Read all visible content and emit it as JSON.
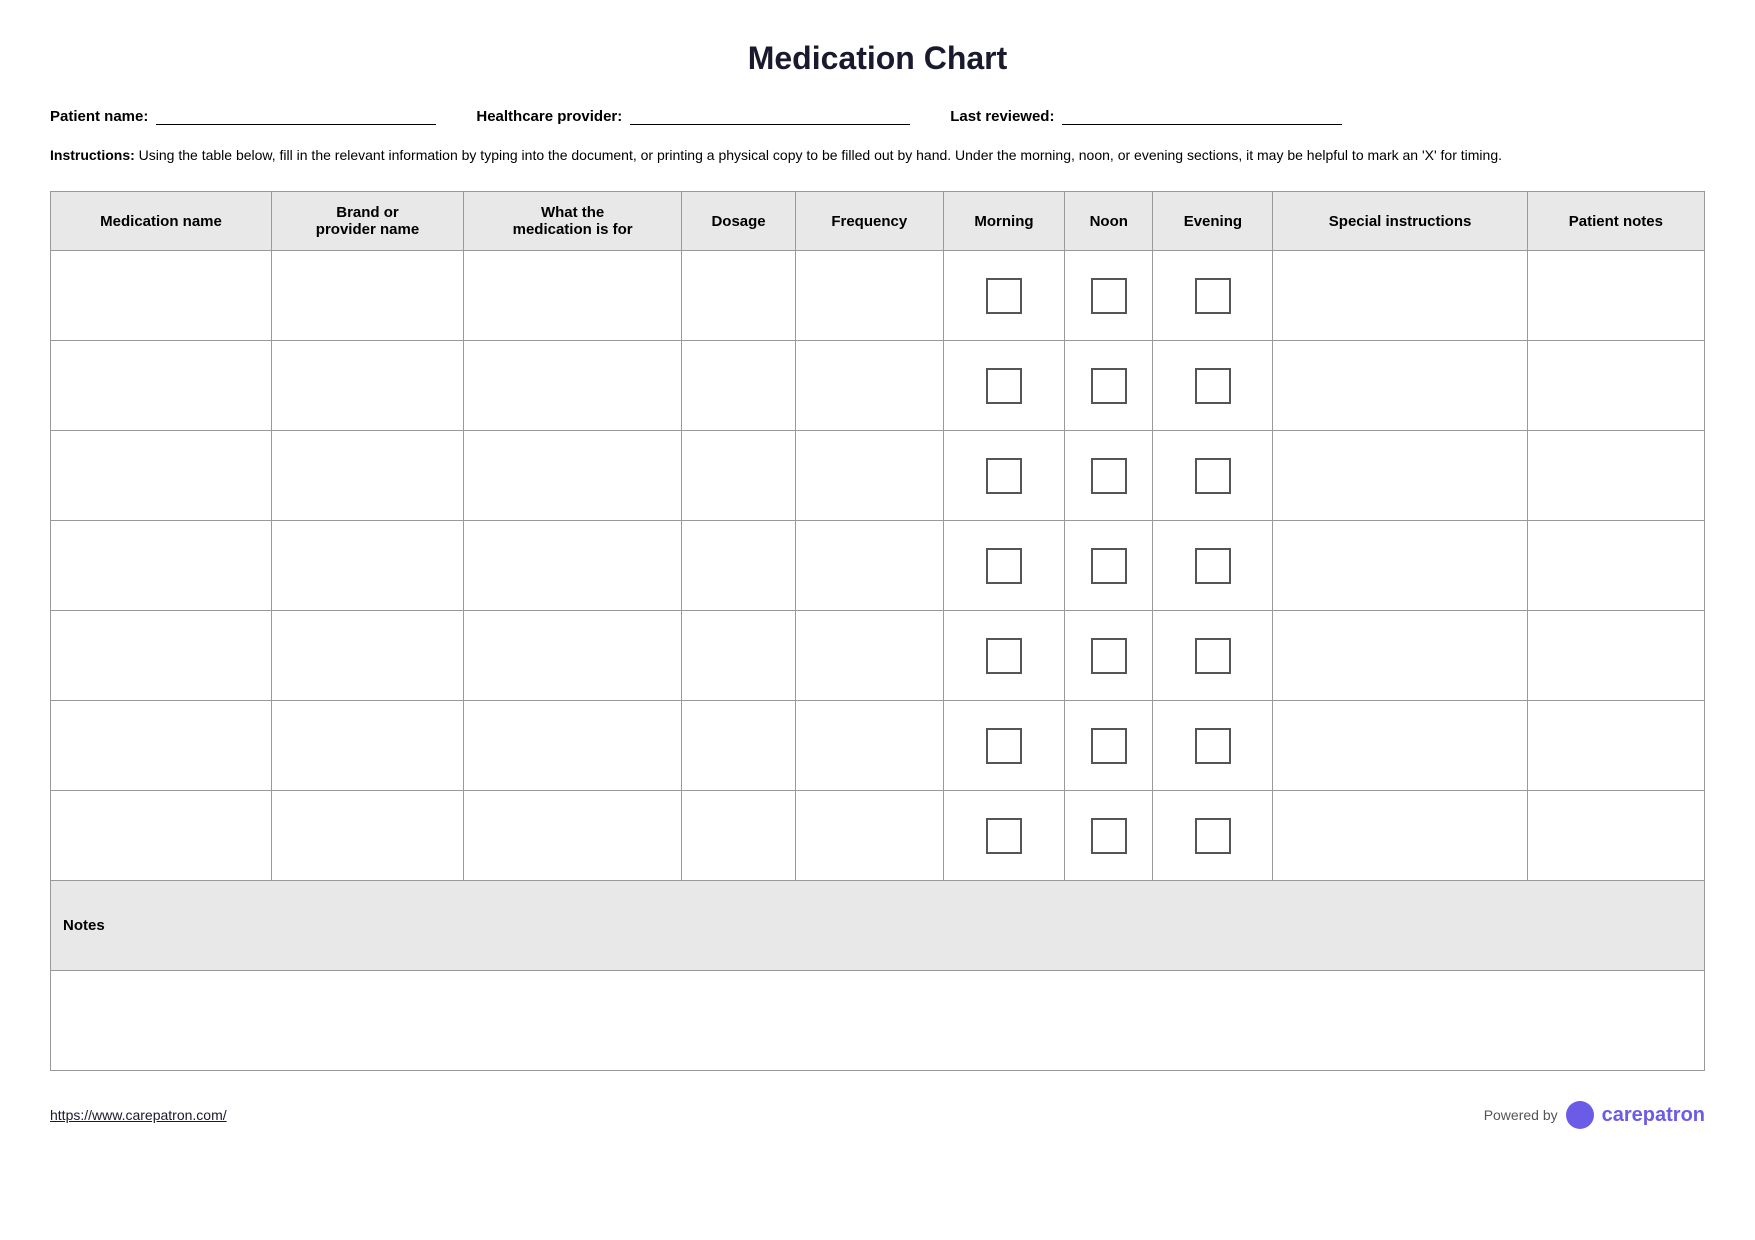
{
  "page": {
    "title": "Medication Chart"
  },
  "patient_info": {
    "patient_name_label": "Patient name:",
    "healthcare_provider_label": "Healthcare provider:",
    "last_reviewed_label": "Last reviewed:"
  },
  "instructions": {
    "bold_part": "Instructions:",
    "text": " Using the table below, fill in the relevant information by typing into the document, or printing a physical copy to be filled out by hand. Under the morning, noon, or evening sections, it may be helpful to mark an 'X' for timing."
  },
  "table": {
    "headers": [
      "Medication name",
      "Brand or provider name",
      "What the medication is for",
      "Dosage",
      "Frequency",
      "Morning",
      "Noon",
      "Evening",
      "Special instructions",
      "Patient notes"
    ],
    "row_count": 7,
    "notes_label": "Notes"
  },
  "footer": {
    "link_text": "https://www.carepatron.com/",
    "powered_by_text": "Powered by",
    "brand_name_regular": "care",
    "brand_name_colored": "patron"
  }
}
